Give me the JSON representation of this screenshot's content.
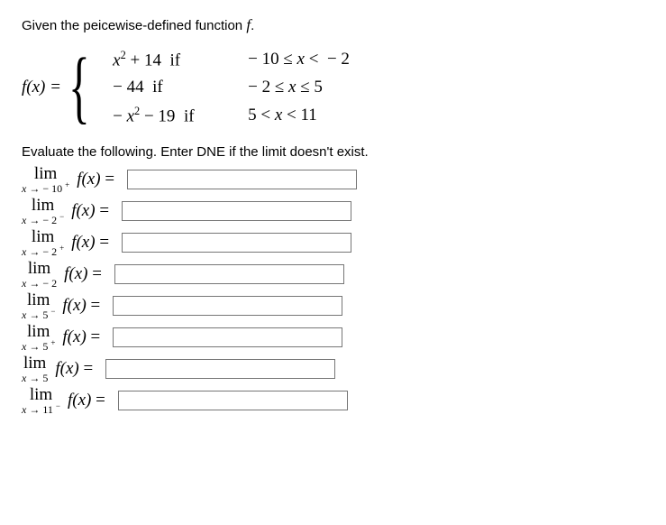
{
  "intro": {
    "prefix": "Given the peicewise-defined function ",
    "func_name": "f",
    "suffix": "."
  },
  "piecewise": {
    "lhs": "f(x) =",
    "pieces": [
      {
        "expr_html": "x<sup>2</sup> + 14",
        "connector": "if",
        "cond_html": "− 10 ≤ x <  − 2"
      },
      {
        "expr_html": "− 44",
        "connector": "if",
        "cond_html": "− 2 ≤ x ≤ 5"
      },
      {
        "expr_html": "− x<sup>2</sup> − 19",
        "connector": "if",
        "cond_html": "5 < x < 11"
      }
    ]
  },
  "instruction": "Evaluate the following. Enter DNE if the limit doesn't exist.",
  "limits": [
    {
      "approach": "x → − 10",
      "side": "+",
      "fx": "f(x)",
      "value": ""
    },
    {
      "approach": "x → − 2",
      "side": "−",
      "fx": "f(x)",
      "value": ""
    },
    {
      "approach": "x → − 2",
      "side": "+",
      "fx": "f(x)",
      "value": ""
    },
    {
      "approach": "x → − 2",
      "side": "",
      "fx": "f(x)",
      "value": ""
    },
    {
      "approach": "x → 5",
      "side": "−",
      "fx": "f(x)",
      "value": ""
    },
    {
      "approach": "x → 5",
      "side": "+",
      "fx": "f(x)",
      "value": ""
    },
    {
      "approach": "x → 5",
      "side": "",
      "fx": "f(x)",
      "value": ""
    },
    {
      "approach": "x → 11",
      "side": "−",
      "fx": "f(x)",
      "value": ""
    }
  ],
  "labels": {
    "lim_word": "lim",
    "equals": "="
  }
}
